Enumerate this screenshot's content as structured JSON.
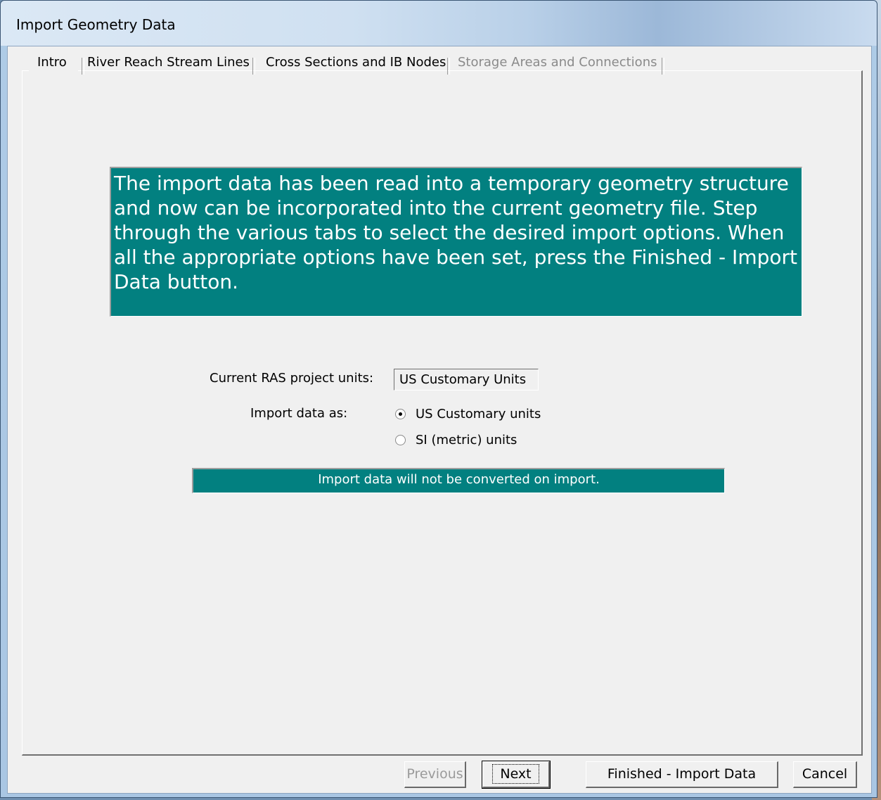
{
  "window": {
    "title": "Import Geometry Data"
  },
  "tabs": [
    {
      "label": "Intro",
      "state": "active"
    },
    {
      "label": "River Reach Stream Lines",
      "state": "normal"
    },
    {
      "label": "Cross Sections and IB Nodes",
      "state": "normal"
    },
    {
      "label": "Storage Areas and Connections",
      "state": "disabled"
    }
  ],
  "intro": {
    "message": "The import data has been read into a temporary geometry structure and now can be incorporated into the current geometry file.  Step through the various tabs to select the desired import options.  When all the appropriate options have been set, press the Finished - Import Data button."
  },
  "units": {
    "current_label": "Current RAS project units:",
    "current_value": "US Customary Units",
    "import_as_label": "Import data as:",
    "options": [
      {
        "label": "US Customary units",
        "checked": true
      },
      {
        "label": "SI (metric) units",
        "checked": false
      }
    ],
    "status_message": "Import data will not be converted on import."
  },
  "buttons": {
    "previous": "Previous",
    "next": "Next",
    "finished": "Finished - Import Data",
    "cancel": "Cancel"
  },
  "colors": {
    "teal": "#028080",
    "dialog_bg": "#f0f0f0"
  }
}
